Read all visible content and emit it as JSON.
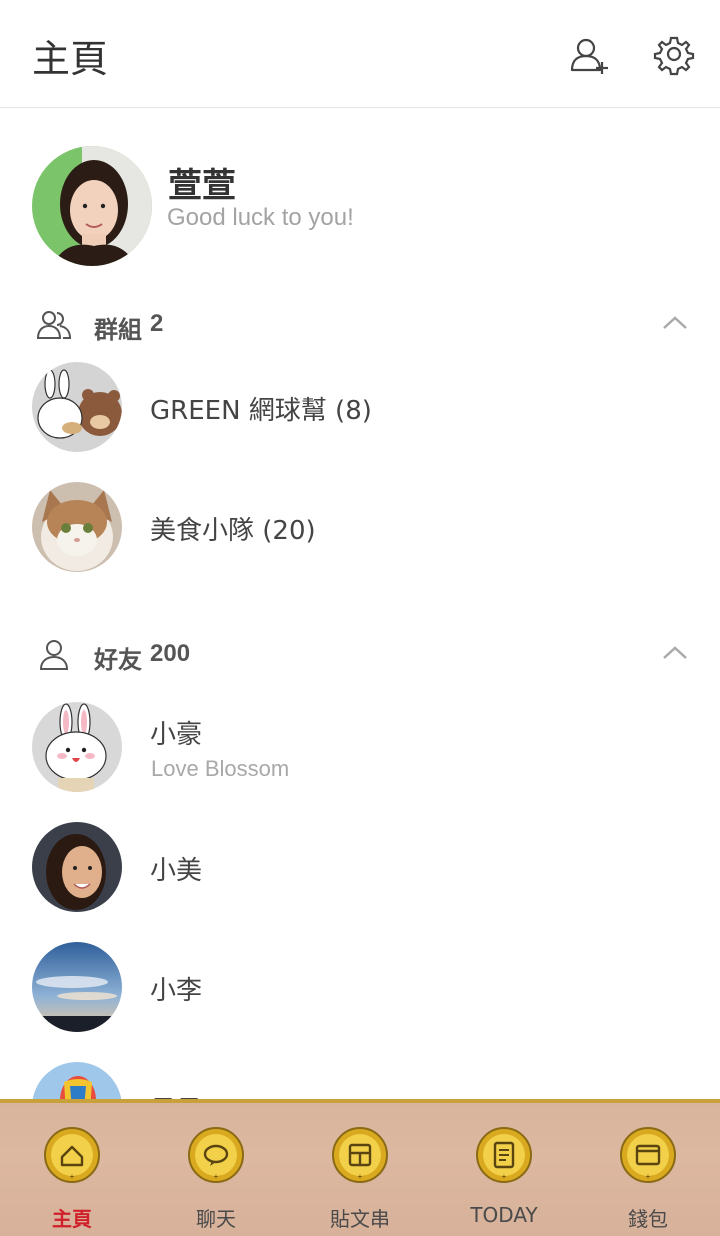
{
  "header": {
    "title": "主頁",
    "add_friend_icon": "add-friend-icon",
    "settings_icon": "gear-icon"
  },
  "profile": {
    "name": "萱萱",
    "status": "Good luck to you!"
  },
  "groups": {
    "label": "群組",
    "count": "2",
    "items": [
      {
        "name": "GREEN 網球幫 (8)"
      },
      {
        "name": "美食小隊 (20)"
      }
    ]
  },
  "friends": {
    "label": "好友",
    "count": "200",
    "items": [
      {
        "name": "小豪",
        "status": "Love Blossom"
      },
      {
        "name": "小美"
      },
      {
        "name": "小李"
      },
      {
        "name": "貝貝"
      }
    ]
  },
  "tabs": [
    {
      "label": "主頁",
      "icon": "home-icon",
      "active": true
    },
    {
      "label": "聊天",
      "icon": "chat-icon"
    },
    {
      "label": "貼文串",
      "icon": "timeline-icon"
    },
    {
      "label": "TODAY",
      "icon": "news-icon"
    },
    {
      "label": "錢包",
      "icon": "wallet-icon"
    }
  ],
  "colors": {
    "accent_active": "#d0202a",
    "tabbar_bg": "#ddb8a0",
    "gold": "#c9a13a"
  }
}
